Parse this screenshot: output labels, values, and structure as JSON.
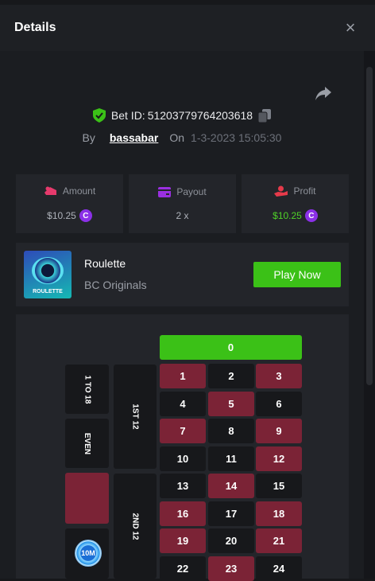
{
  "header": {
    "title": "Details",
    "close_label": "×"
  },
  "bet": {
    "id_label": "Bet ID:",
    "id": "51203779764203618",
    "by_label": "By",
    "user": "bassabar",
    "on_label": "On",
    "time": "1-3-2023 15:05:30"
  },
  "stats": {
    "amount": {
      "label": "Amount",
      "value": "$10.25"
    },
    "payout": {
      "label": "Payout",
      "value": "2 x"
    },
    "profit": {
      "label": "Profit",
      "value": "$10.25"
    }
  },
  "game": {
    "name": "Roulette",
    "provider": "BC Originals",
    "thumb_label": "ROULETTE",
    "play_label": "Play Now"
  },
  "board": {
    "zero": "0",
    "side_labels": [
      "1 TO 18",
      "EVEN"
    ],
    "dozens": [
      "1ST 12",
      "2ND 12"
    ],
    "chip_label": "10M",
    "rows": [
      [
        {
          "n": "1",
          "c": "red"
        },
        {
          "n": "2",
          "c": "black"
        },
        {
          "n": "3",
          "c": "red"
        }
      ],
      [
        {
          "n": "4",
          "c": "black"
        },
        {
          "n": "5",
          "c": "red"
        },
        {
          "n": "6",
          "c": "black"
        }
      ],
      [
        {
          "n": "7",
          "c": "red"
        },
        {
          "n": "8",
          "c": "black"
        },
        {
          "n": "9",
          "c": "red"
        }
      ],
      [
        {
          "n": "10",
          "c": "black"
        },
        {
          "n": "11",
          "c": "black"
        },
        {
          "n": "12",
          "c": "red"
        }
      ],
      [
        {
          "n": "13",
          "c": "black"
        },
        {
          "n": "14",
          "c": "red"
        },
        {
          "n": "15",
          "c": "black"
        }
      ],
      [
        {
          "n": "16",
          "c": "red"
        },
        {
          "n": "17",
          "c": "black"
        },
        {
          "n": "18",
          "c": "red"
        }
      ],
      [
        {
          "n": "19",
          "c": "red"
        },
        {
          "n": "20",
          "c": "black"
        },
        {
          "n": "21",
          "c": "red"
        }
      ],
      [
        {
          "n": "22",
          "c": "black"
        },
        {
          "n": "23",
          "c": "red"
        },
        {
          "n": "24",
          "c": "black"
        }
      ]
    ]
  },
  "colors": {
    "accent_green": "#3bc117",
    "roulette_red": "#7b2336",
    "coin_purple": "#8b30e8"
  }
}
